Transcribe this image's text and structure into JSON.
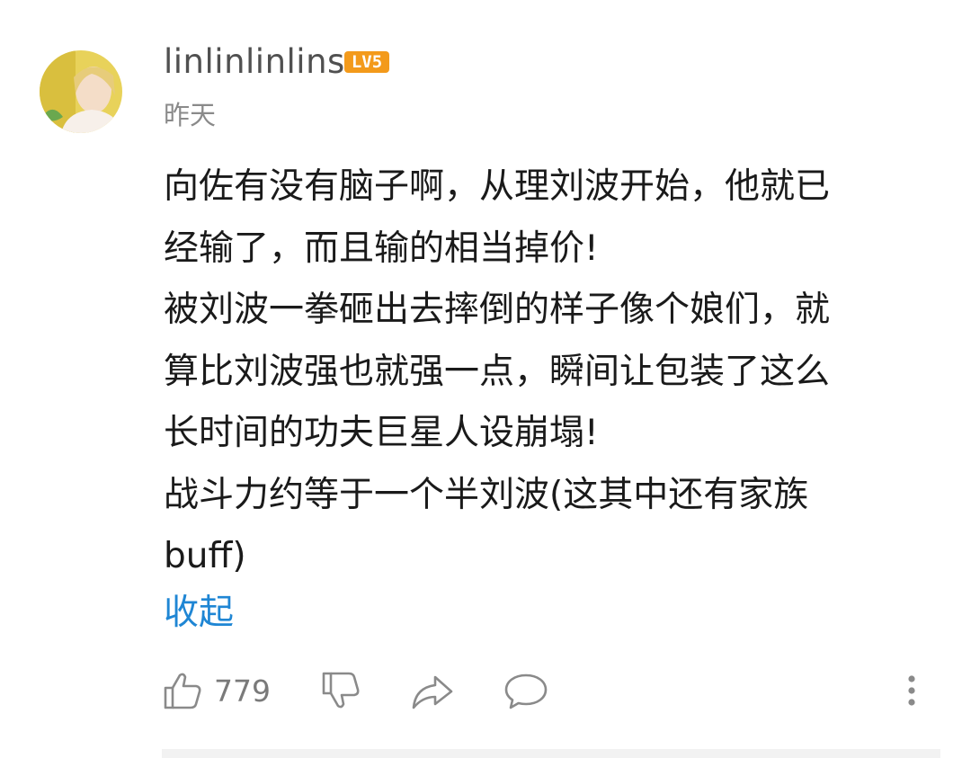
{
  "comment": {
    "username": "linlinlinlins",
    "level_badge": "LV5",
    "date": "昨天",
    "lines": [
      "向佐有没有脑子啊，从理刘波开始，他就已",
      "经输了，而且输的相当掉价!",
      "被刘波一拳砸出去摔倒的样子像个娘们，就",
      "算比刘波强也就强一点，瞬间让包装了这么",
      "长时间的功夫巨星人设崩塌!",
      "战斗力约等于一个半刘波(这其中还有家族",
      "buff)"
    ],
    "collapse_label": "收起"
  },
  "actions": {
    "like_count": "779",
    "icons": [
      "thumbs-up-icon",
      "thumbs-down-icon",
      "share-icon",
      "reply-bubble-icon",
      "more-vertical-icon"
    ]
  },
  "colors": {
    "badge": "#f39a1b",
    "link": "#1f86d4",
    "icon": "#8a8a8a"
  }
}
